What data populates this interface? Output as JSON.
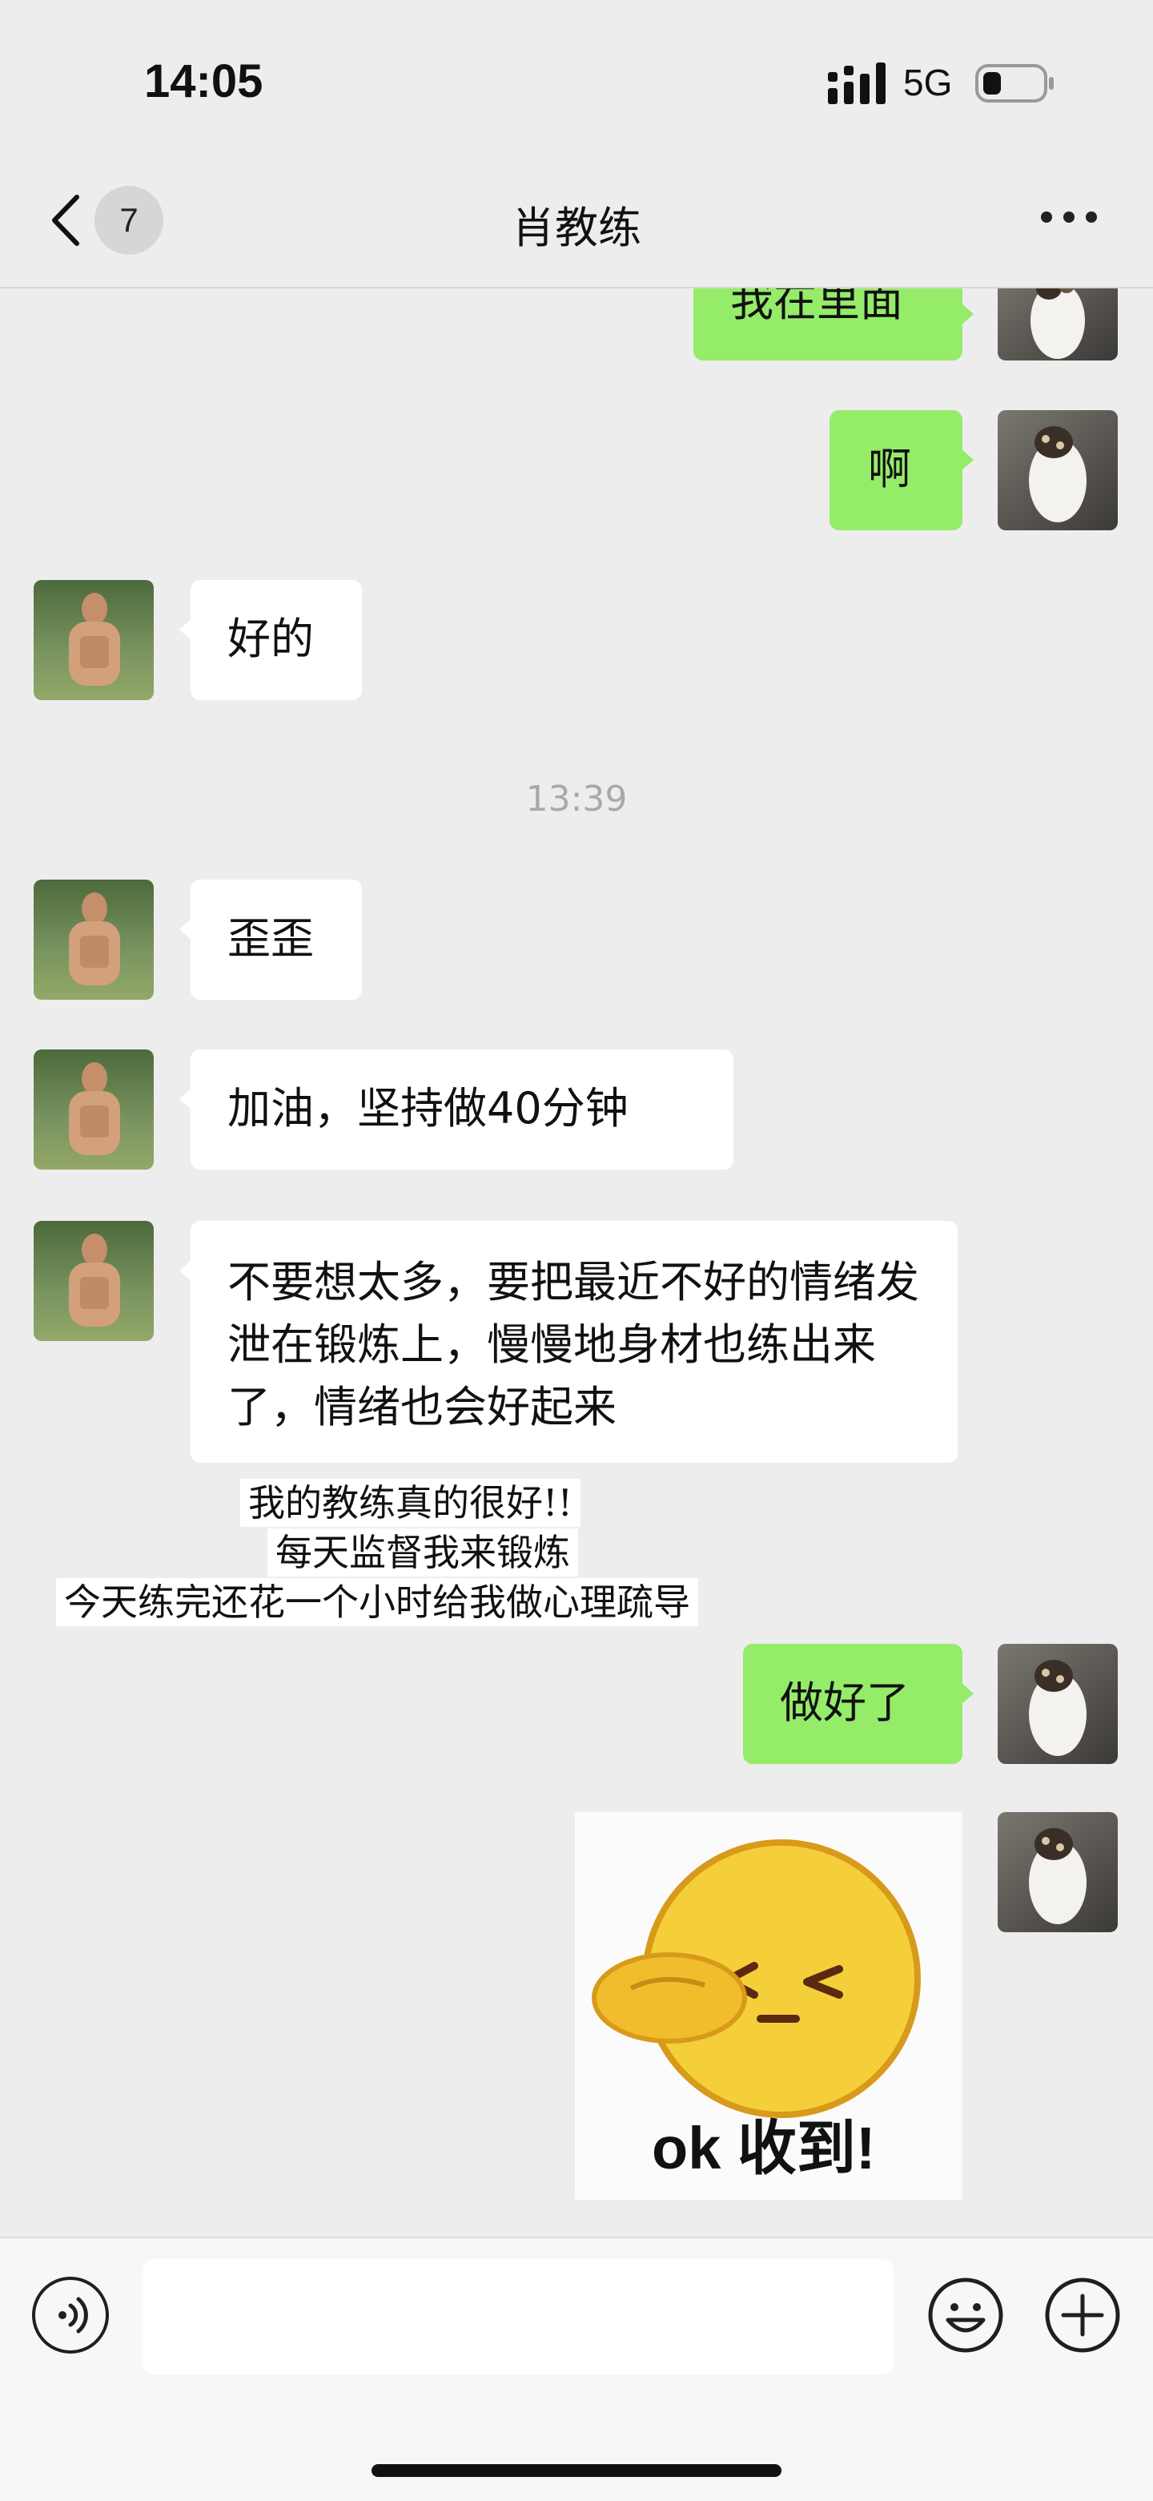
{
  "status_bar": {
    "time": "14:05",
    "network": "5G",
    "signal_icon": "signal-bars-icon",
    "battery_icon": "battery-icon"
  },
  "nav": {
    "title": "肖教练",
    "unread_count": "7",
    "back_icon": "chevron-left-icon",
    "more_icon": "more-dots-icon"
  },
  "messages": [
    {
      "side": "right",
      "text": "我在里面"
    },
    {
      "side": "right",
      "text": "啊"
    },
    {
      "side": "left",
      "text": "好的"
    },
    {
      "side": "left",
      "text": "歪歪"
    },
    {
      "side": "left",
      "text": "加油，坚持做40分钟"
    },
    {
      "side": "left",
      "text": "不要想太多，要把最近不好的情绪发泄在锻炼上，慢慢地身材也练出来了，情绪也会好起来"
    },
    {
      "side": "right",
      "text": "做好了"
    }
  ],
  "timestamp": "13:39",
  "captions": [
    "我的教练真的很好!!",
    "每天监督我来锻炼",
    "今天练完还花一个小时给我做心理疏导"
  ],
  "sticker": {
    "text": "ok 收到!"
  },
  "input_bar": {
    "voice_icon": "voice-icon",
    "emoji_icon": "emoji-icon",
    "plus_icon": "plus-icon",
    "value": ""
  },
  "colors": {
    "own_bubble": "#95ec69",
    "other_bubble": "#ffffff",
    "background": "#ededed"
  }
}
